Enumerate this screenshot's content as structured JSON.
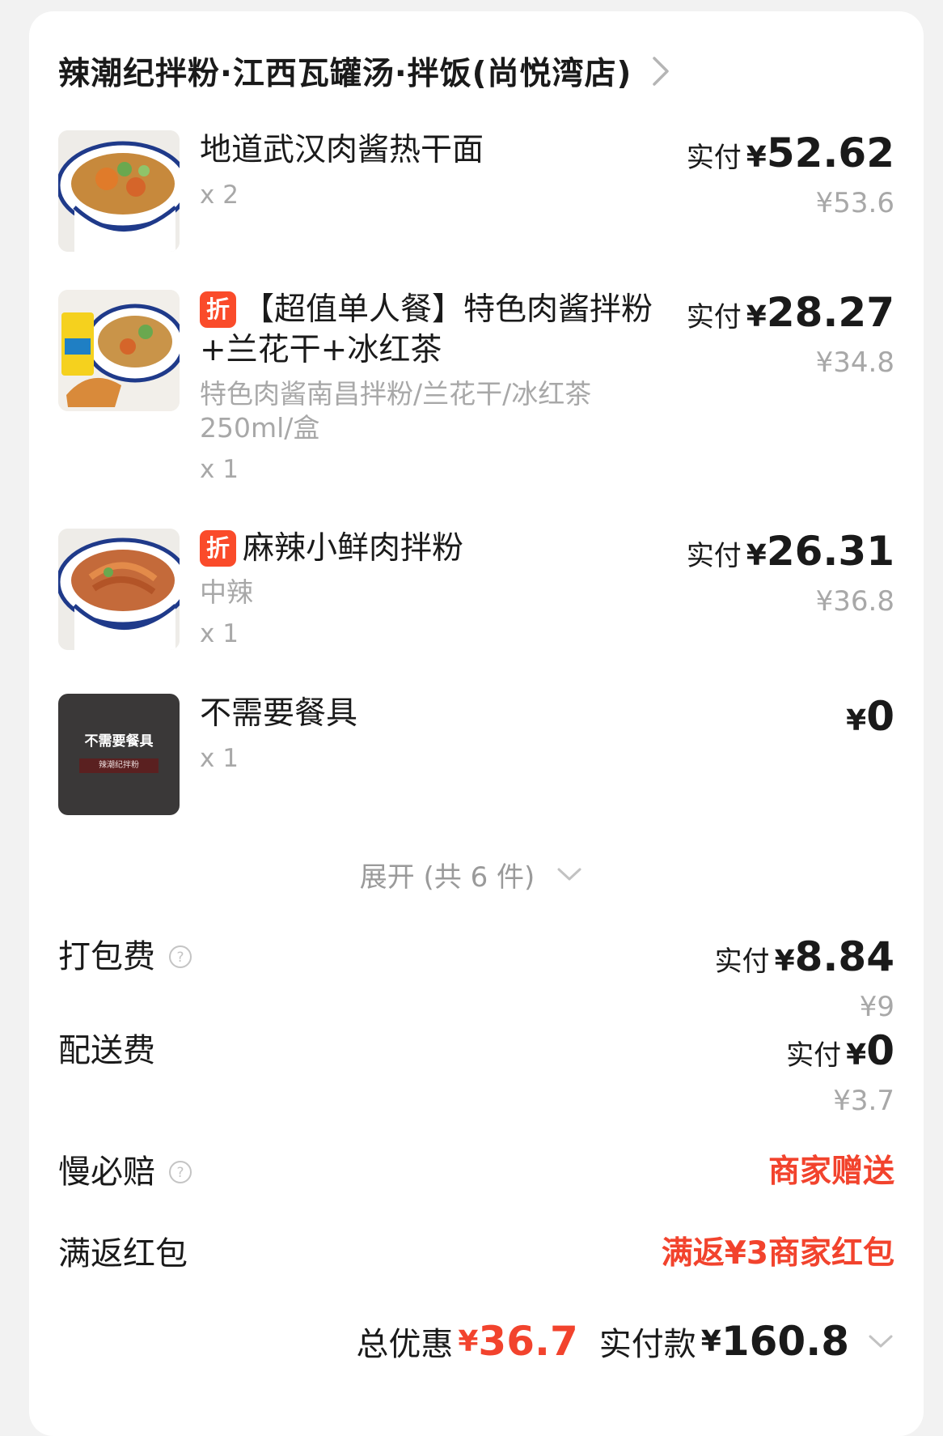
{
  "store": {
    "name": "辣潮纪拌粉·江西瓦罐汤·拌饭(尚悦湾店)"
  },
  "items": [
    {
      "name": "地道武汉肉酱热干面",
      "qty": "x 2",
      "paid_label": "实付",
      "currency": "¥",
      "paid": "52.62",
      "original": "¥53.6"
    },
    {
      "badge": "折",
      "name": "【超值单人餐】特色肉酱拌粉+兰花干+冰红茶",
      "spec": "特色肉酱南昌拌粉/兰花干/冰红茶250ml/盒",
      "qty": "x 1",
      "paid_label": "实付",
      "currency": "¥",
      "paid": "28.27",
      "original": "¥34.8"
    },
    {
      "badge": "折",
      "name": "麻辣小鲜肉拌粉",
      "spec": "中辣",
      "qty": "x 1",
      "paid_label": "实付",
      "currency": "¥",
      "paid": "26.31",
      "original": "¥36.8"
    },
    {
      "name": "不需要餐具",
      "qty": "x 1",
      "currency": "¥",
      "paid": "0",
      "image_text": "不需要餐具",
      "image_subtext": "辣潮纪拌粉"
    }
  ],
  "expand": {
    "label": "展开 (共 6 件)"
  },
  "fees": {
    "packing": {
      "label": "打包费",
      "paid_label": "实付",
      "currency": "¥",
      "paid": "8.84",
      "original": "¥9"
    },
    "delivery": {
      "label": "配送费",
      "paid_label": "实付",
      "currency": "¥",
      "paid": "0",
      "original": "¥3.7"
    },
    "late_guarantee": {
      "label": "慢必赔",
      "value": "商家赠送"
    },
    "red_packet": {
      "label": "满返红包",
      "value": "满返¥3商家红包"
    }
  },
  "summary": {
    "discount_label": "总优惠",
    "currency": "¥",
    "discount": "36.7",
    "paid_label": "实付款",
    "paid": "160.8"
  },
  "colors": {
    "accent_red": "#f2432d",
    "badge_red": "#fa4b2a",
    "muted": "#a8a8a8"
  },
  "icons": [
    "chevron-right-icon",
    "chevron-down-icon",
    "help-circle-icon",
    "discount-badge"
  ]
}
